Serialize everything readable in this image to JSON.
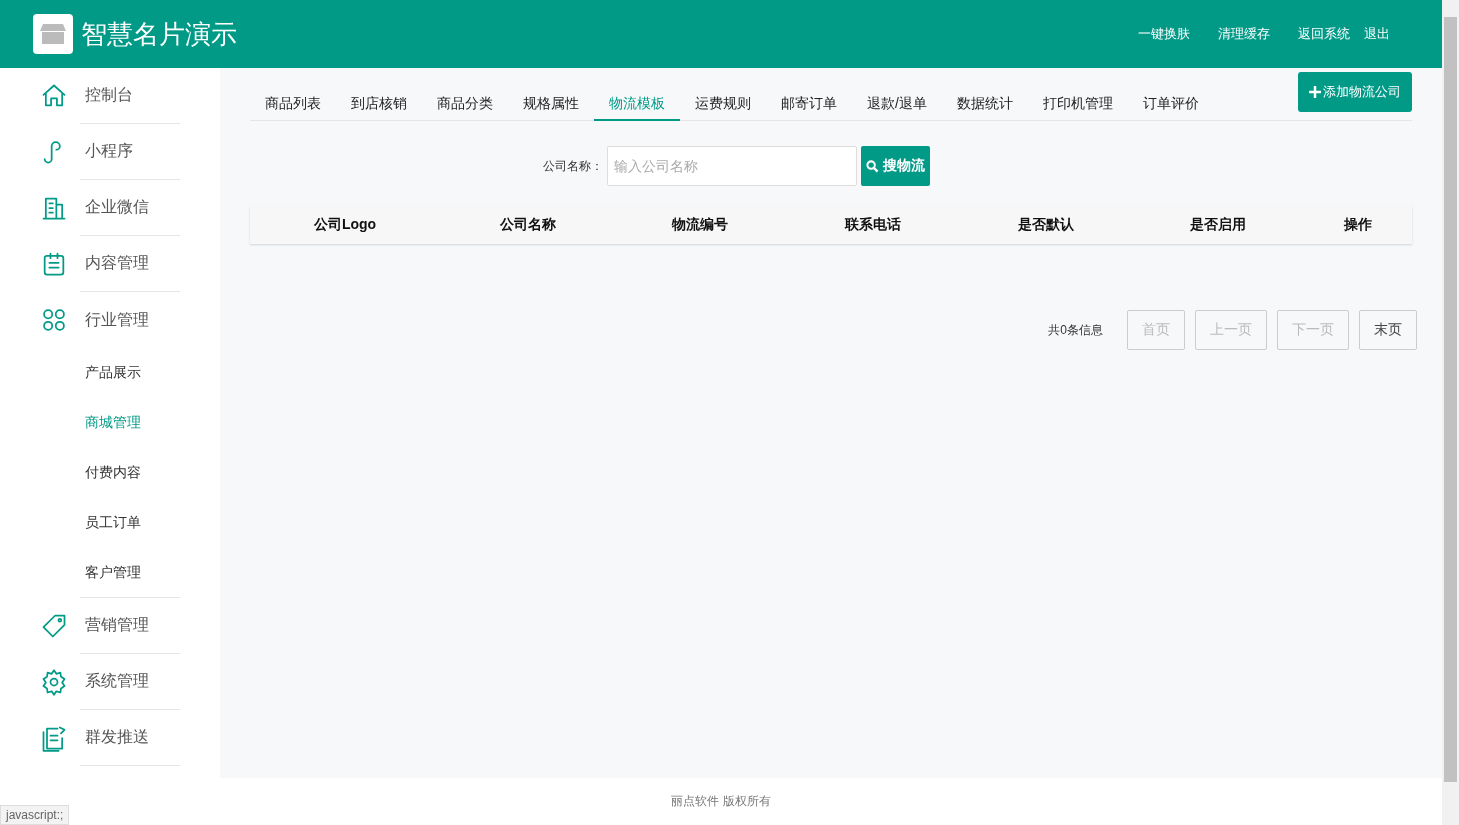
{
  "header": {
    "title": "智慧名片演示",
    "links": [
      "一键换肤",
      "清理缓存",
      "返回系统",
      "退出"
    ]
  },
  "sidebar": {
    "items": [
      {
        "kind": "main",
        "label": "控制台",
        "selected": false
      },
      {
        "kind": "main",
        "label": "小程序",
        "selected": false
      },
      {
        "kind": "main",
        "label": "企业微信",
        "selected": false
      },
      {
        "kind": "main",
        "label": "内容管理",
        "selected": false
      },
      {
        "kind": "main",
        "label": "行业管理",
        "selected": false
      },
      {
        "kind": "sub",
        "label": "产品展示",
        "selected": false
      },
      {
        "kind": "sub",
        "label": "商城管理",
        "selected": true
      },
      {
        "kind": "sub",
        "label": "付费内容",
        "selected": false
      },
      {
        "kind": "sub",
        "label": "员工订单",
        "selected": false
      },
      {
        "kind": "sub",
        "label": "客户管理",
        "selected": false
      },
      {
        "kind": "main",
        "label": "营销管理",
        "selected": false
      },
      {
        "kind": "main",
        "label": "系统管理",
        "selected": false
      },
      {
        "kind": "main",
        "label": "群发推送",
        "selected": false
      }
    ]
  },
  "tabs": [
    {
      "label": "商品列表",
      "selected": false
    },
    {
      "label": "到店核销",
      "selected": false
    },
    {
      "label": "商品分类",
      "selected": false
    },
    {
      "label": "规格属性",
      "selected": false
    },
    {
      "label": "物流模板",
      "selected": true
    },
    {
      "label": "运费规则",
      "selected": false
    },
    {
      "label": "邮寄订单",
      "selected": false
    },
    {
      "label": "退款/退单",
      "selected": false
    },
    {
      "label": "数据统计",
      "selected": false
    },
    {
      "label": "打印机管理",
      "selected": false
    },
    {
      "label": "订单评价",
      "selected": false
    }
  ],
  "add_button": "添加物流公司",
  "search": {
    "label": "公司名称：",
    "placeholder": "输入公司名称",
    "button": "搜物流"
  },
  "table": {
    "columns": [
      "公司Logo",
      "公司名称",
      "物流编号",
      "联系电话",
      "是否默认",
      "是否启用",
      "操作"
    ]
  },
  "pagination": {
    "summary": "共0条信息",
    "buttons": [
      {
        "label": "首页",
        "disabled": true
      },
      {
        "label": "上一页",
        "disabled": true
      },
      {
        "label": "下一页",
        "disabled": true
      },
      {
        "label": "末页",
        "disabled": false
      }
    ]
  },
  "footer": "丽点软件 版权所有",
  "status_url": "javascript:;"
}
